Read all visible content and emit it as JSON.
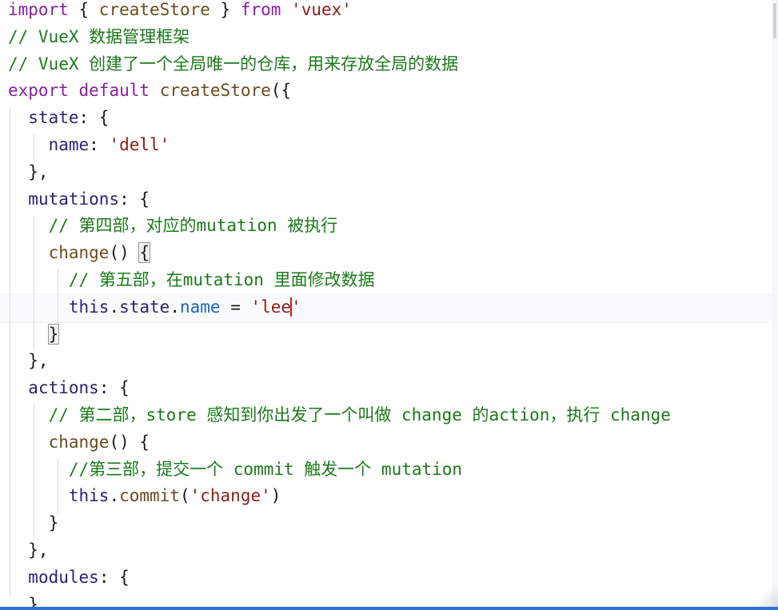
{
  "editor": {
    "language": "javascript",
    "lines": [
      {
        "id": "l1",
        "tokens": [
          [
            "kw",
            "import"
          ],
          [
            "punc",
            " { "
          ],
          [
            "fn",
            "createStore"
          ],
          [
            "punc",
            " } "
          ],
          [
            "kw",
            "from"
          ],
          [
            "punc",
            " "
          ],
          [
            "str",
            "'vuex'"
          ]
        ]
      },
      {
        "id": "l2",
        "tokens": [
          [
            "cm",
            "// VueX 数据管理框架"
          ]
        ]
      },
      {
        "id": "l3",
        "tokens": [
          [
            "cm",
            "// VueX 创建了一个全局唯一的仓库，用来存放全局的数据"
          ]
        ]
      },
      {
        "id": "l4",
        "tokens": [
          [
            "kw",
            "export"
          ],
          [
            "punc",
            " "
          ],
          [
            "kw",
            "default"
          ],
          [
            "punc",
            " "
          ],
          [
            "fn",
            "createStore"
          ],
          [
            "punc",
            "({"
          ]
        ]
      },
      {
        "id": "l5",
        "tokens": [
          [
            "punc",
            "  "
          ],
          [
            "prop",
            "state"
          ],
          [
            "punc",
            ": {"
          ]
        ]
      },
      {
        "id": "l6",
        "tokens": [
          [
            "punc",
            "    "
          ],
          [
            "prop",
            "name"
          ],
          [
            "punc",
            ": "
          ],
          [
            "str",
            "'dell'"
          ]
        ]
      },
      {
        "id": "l7",
        "tokens": [
          [
            "punc",
            "  },"
          ]
        ]
      },
      {
        "id": "l8",
        "tokens": [
          [
            "punc",
            "  "
          ],
          [
            "prop",
            "mutations"
          ],
          [
            "punc",
            ": {"
          ]
        ]
      },
      {
        "id": "l9",
        "tokens": [
          [
            "punc",
            "    "
          ],
          [
            "cm",
            "// 第四部，对应的mutation 被执行"
          ]
        ]
      },
      {
        "id": "l10",
        "tokens": [
          [
            "punc",
            "    "
          ],
          [
            "fn",
            "change"
          ],
          [
            "punc",
            "() "
          ],
          [
            "box",
            "{"
          ]
        ]
      },
      {
        "id": "l11",
        "tokens": [
          [
            "punc",
            "      "
          ],
          [
            "cm",
            "// 第五部，在mutation 里面修改数据"
          ]
        ]
      },
      {
        "id": "l12",
        "tokens": [
          [
            "punc",
            "      "
          ],
          [
            "this",
            "this"
          ],
          [
            "punc",
            "."
          ],
          [
            "this",
            "state"
          ],
          [
            "punc",
            "."
          ],
          [
            "blue",
            "name"
          ],
          [
            "punc",
            " = "
          ],
          [
            "str",
            "'lee"
          ],
          [
            "caret",
            ""
          ],
          [
            "str",
            "'"
          ]
        ]
      },
      {
        "id": "l13",
        "tokens": [
          [
            "punc",
            "    "
          ],
          [
            "box",
            "}"
          ]
        ]
      },
      {
        "id": "l14",
        "tokens": [
          [
            "punc",
            "  },"
          ]
        ]
      },
      {
        "id": "l15",
        "tokens": [
          [
            "punc",
            "  "
          ],
          [
            "prop",
            "actions"
          ],
          [
            "punc",
            ": {"
          ]
        ]
      },
      {
        "id": "l16",
        "tokens": [
          [
            "punc",
            "    "
          ],
          [
            "cm",
            "// 第二部，store 感知到你出发了一个叫做 change 的action，执行 change"
          ]
        ]
      },
      {
        "id": "l17",
        "tokens": [
          [
            "punc",
            "    "
          ],
          [
            "fn",
            "change"
          ],
          [
            "punc",
            "() {"
          ]
        ]
      },
      {
        "id": "l18",
        "tokens": [
          [
            "punc",
            "      "
          ],
          [
            "cm",
            "//第三部，提交一个 commit 触发一个 mutation"
          ]
        ]
      },
      {
        "id": "l19",
        "tokens": [
          [
            "punc",
            "      "
          ],
          [
            "this",
            "this"
          ],
          [
            "punc",
            "."
          ],
          [
            "fn",
            "commit"
          ],
          [
            "punc",
            "("
          ],
          [
            "str",
            "'change'"
          ],
          [
            "punc",
            ")"
          ]
        ]
      },
      {
        "id": "l20",
        "tokens": [
          [
            "punc",
            "    }"
          ]
        ]
      },
      {
        "id": "l21",
        "tokens": [
          [
            "punc",
            "  },"
          ]
        ]
      },
      {
        "id": "l22",
        "tokens": [
          [
            "punc",
            "  "
          ],
          [
            "prop",
            "modules"
          ],
          [
            "punc",
            ": {"
          ]
        ]
      },
      {
        "id": "l23",
        "tokens": [
          [
            "punc",
            "  }"
          ]
        ]
      }
    ],
    "colors": {
      "keyword": "#8a1ea0",
      "string": "#8b1a1a",
      "comment": "#1b7a1b",
      "function": "#6c4a1a",
      "property": "#2c1f78",
      "accent": "#2f72d6"
    }
  }
}
